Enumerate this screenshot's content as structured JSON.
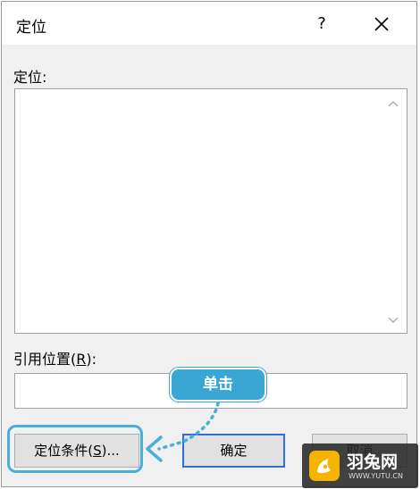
{
  "dialog": {
    "title": "定位",
    "help_label": "?",
    "goto_label": "定位:",
    "reference_label_prefix": "引用位置(",
    "reference_label_key": "R",
    "reference_label_suffix": "):",
    "reference_value": ""
  },
  "buttons": {
    "special_prefix": "定位条件(",
    "special_key": "S",
    "special_suffix": ")...",
    "ok_label": "确定",
    "cancel_label": "取消"
  },
  "annotation": {
    "callout_text": "单击",
    "color": "#3aa6d4"
  },
  "watermark": {
    "brand": "羽兔网",
    "url": "WWW.YUTU.CN"
  }
}
